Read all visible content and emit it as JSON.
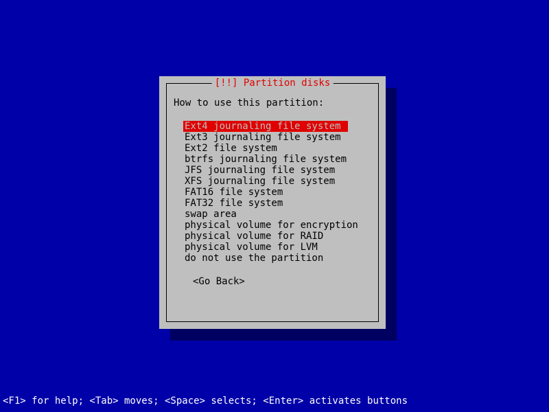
{
  "dialog": {
    "title_prefix": "[!!]",
    "title": "Partition disks",
    "prompt": "How to use this partition:",
    "options": [
      "Ext4 journaling file system",
      "Ext3 journaling file system",
      "Ext2 file system",
      "btrfs journaling file system",
      "JFS journaling file system",
      "XFS journaling file system",
      "FAT16 file system",
      "FAT32 file system",
      "swap area",
      "physical volume for encryption",
      "physical volume for RAID",
      "physical volume for LVM",
      "do not use the partition"
    ],
    "selected_index": 0,
    "go_back": "<Go Back>"
  },
  "help_bar": "<F1> for help; <Tab> moves; <Space> selects; <Enter> activates buttons"
}
